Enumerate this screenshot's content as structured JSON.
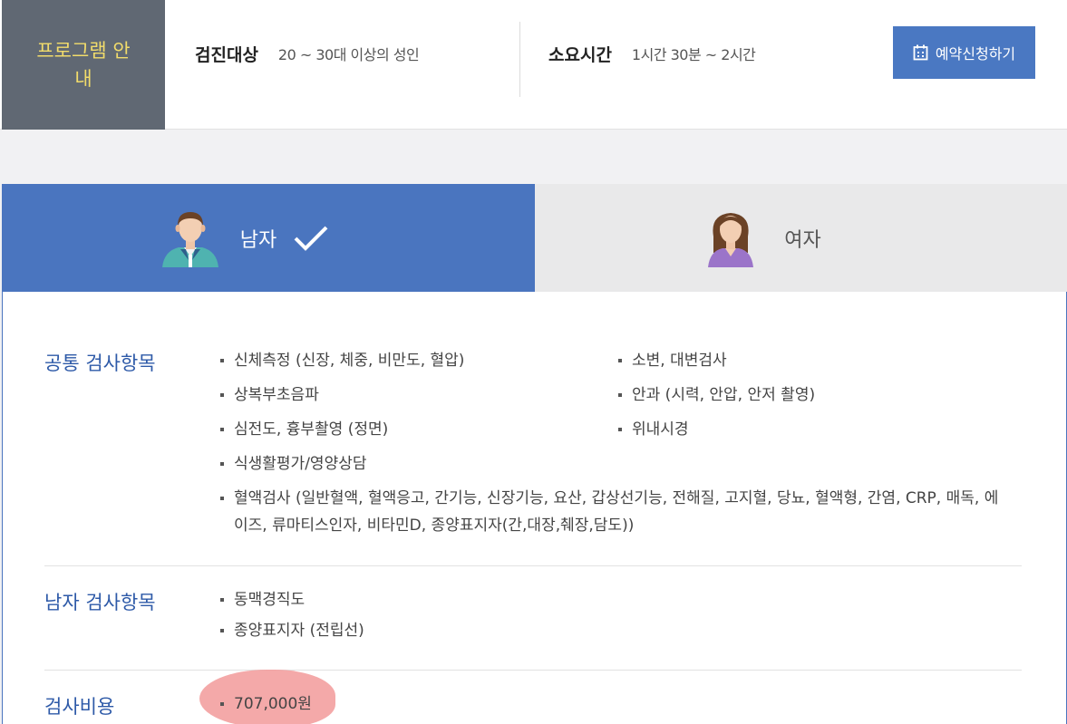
{
  "header": {
    "program": "프로그램 안내",
    "target_label": "검진대상",
    "target_value": "20 ~ 30대 이상의 성인",
    "time_label": "소요시간",
    "time_value": "1시간 30분 ~ 2시간",
    "reserve_button": "예약신청하기"
  },
  "tabs": [
    {
      "label": "남자",
      "selected": true
    },
    {
      "label": "여자",
      "selected": false
    }
  ],
  "sections": {
    "common": {
      "title": "공통 검사항목",
      "col1": [
        "신체측정 (신장, 체중, 비만도, 혈압)",
        "상복부초음파",
        "심전도, 흉부촬영 (정면)",
        "식생활평가/영양상담",
        "혈액검사 (일반혈액, 혈액응고, 간기능, 신장기능, 요산, 갑상선기능, 전해질, 고지혈, 당뇨, 혈액형, 간염, CRP, 매독, 에이즈, 류마티스인자, 비타민D, 종양표지자(간,대장,췌장,담도))"
      ],
      "col2": [
        "소변, 대변검사",
        "안과 (시력, 안압, 안저 촬영)",
        "위내시경"
      ]
    },
    "male": {
      "title": "남자 검사항목",
      "items": [
        "동맥경직도",
        "종양표지자 (전립선)"
      ]
    },
    "cost": {
      "title": "검사비용",
      "items": [
        "707,000원"
      ]
    }
  },
  "colors": {
    "accent": "#4a75bf",
    "program_bg": "#606873",
    "program_text": "#f2dc6b",
    "highlight": "#f29a9a"
  }
}
